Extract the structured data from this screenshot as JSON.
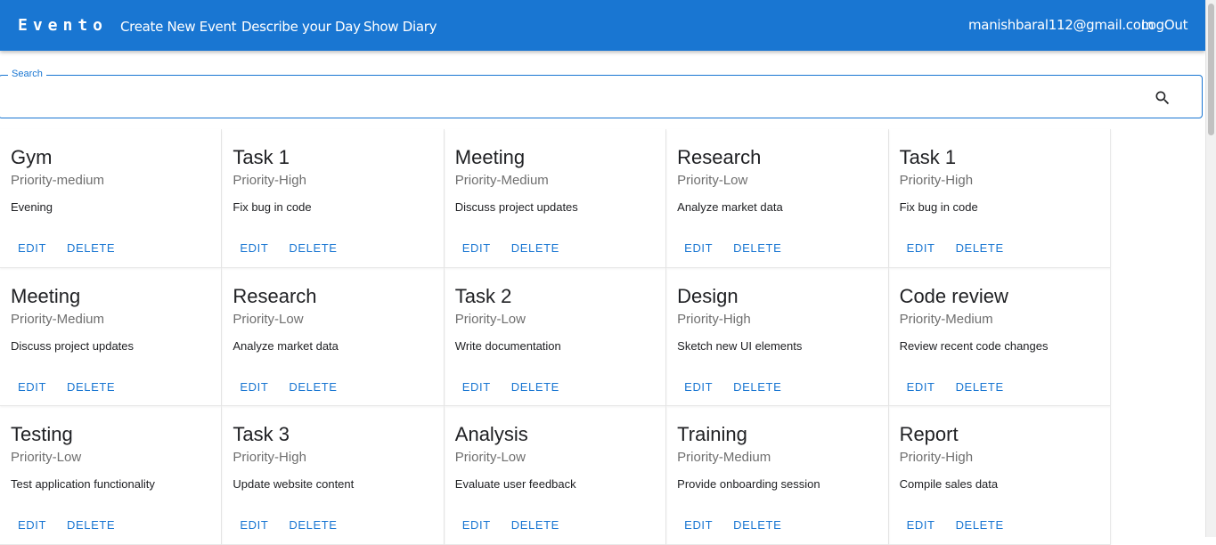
{
  "nav": {
    "brand": "Evento",
    "links": [
      "Create New Event",
      "Describe your Day",
      "Show Diary"
    ],
    "user_email": "manishbaral112@gmail.com",
    "logout": "LogOut"
  },
  "search": {
    "label": "Search",
    "value": "",
    "placeholder": ""
  },
  "card_actions": {
    "edit": "EDIT",
    "delete": "DELETE"
  },
  "cards": [
    {
      "title": "Gym",
      "priority": "Priority-medium",
      "description": "Evening"
    },
    {
      "title": "Task 1",
      "priority": "Priority-High",
      "description": "Fix bug in code"
    },
    {
      "title": "Meeting",
      "priority": "Priority-Medium",
      "description": "Discuss project updates"
    },
    {
      "title": "Research",
      "priority": "Priority-Low",
      "description": "Analyze market data"
    },
    {
      "title": "Task 1",
      "priority": "Priority-High",
      "description": "Fix bug in code"
    },
    {
      "title": "Meeting",
      "priority": "Priority-Medium",
      "description": "Discuss project updates"
    },
    {
      "title": "Research",
      "priority": "Priority-Low",
      "description": "Analyze market data"
    },
    {
      "title": "Task 2",
      "priority": "Priority-Low",
      "description": "Write documentation"
    },
    {
      "title": "Design",
      "priority": "Priority-High",
      "description": "Sketch new UI elements"
    },
    {
      "title": "Code review",
      "priority": "Priority-Medium",
      "description": "Review recent code changes"
    },
    {
      "title": "Testing",
      "priority": "Priority-Low",
      "description": "Test application functionality"
    },
    {
      "title": "Task 3",
      "priority": "Priority-High",
      "description": "Update website content"
    },
    {
      "title": "Analysis",
      "priority": "Priority-Low",
      "description": "Evaluate user feedback"
    },
    {
      "title": "Training",
      "priority": "Priority-Medium",
      "description": "Provide onboarding session"
    },
    {
      "title": "Report",
      "priority": "Priority-High",
      "description": "Compile sales data"
    }
  ],
  "colors": {
    "primary": "#1976d2",
    "priority_text": "#6f6f6f"
  },
  "icons": {
    "search": "search-icon"
  }
}
